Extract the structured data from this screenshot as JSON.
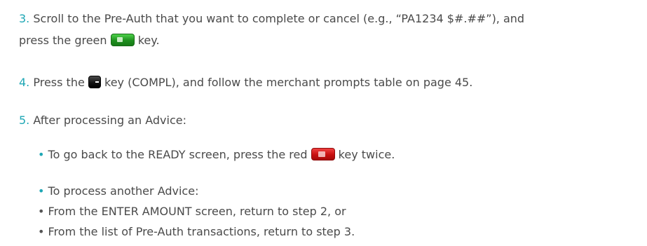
{
  "steps": [
    {
      "number": "3.",
      "line1": "Scroll to the Pre-Auth that you want to complete or cancel (e.g., “PA1234 $#.##”), and",
      "line2_before_key": "press the green",
      "line2_after_key": "key."
    },
    {
      "number": "4.",
      "before_key": "Press the",
      "after_key": "key (COMPL), and follow the merchant prompts table on page 45."
    },
    {
      "number": "5.",
      "text": "After processing an Advice:",
      "bullets": [
        {
          "before_key": "To go back to the READY screen, press the red",
          "after_key": "key twice."
        },
        {
          "text": "To process another Advice:",
          "subbullets": [
            "From the ENTER AMOUNT screen, return to step 2, or",
            "From the list of Pre-Auth transactions, return to step 3."
          ]
        }
      ]
    }
  ],
  "keys": {
    "green": {
      "color": "#2db82d",
      "icon": "green-enter-key-icon"
    },
    "black": {
      "color": "#111111",
      "icon": "black-function-key-icon"
    },
    "red": {
      "color": "#d81b1b",
      "icon": "red-cancel-key-icon"
    }
  },
  "colors": {
    "number": "#1fa7b5",
    "text": "#4a4a4a",
    "bullet_level1": "#1fa7b5",
    "bullet_level2": "#555555"
  }
}
